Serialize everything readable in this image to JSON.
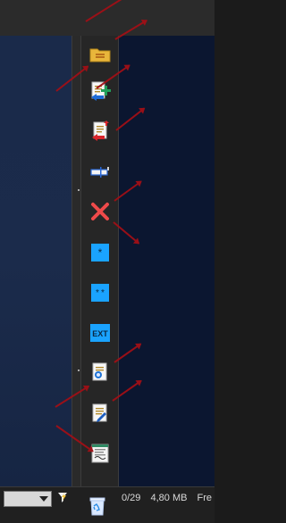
{
  "status": {
    "count": "0/29",
    "size": "4,80 MB",
    "truncated_tail": "Fre"
  },
  "toolbar": {
    "buttons": [
      {
        "name": "open-folder-button",
        "icon": "folder-icon"
      },
      {
        "name": "new-document-button",
        "icon": "document-add-icon"
      },
      {
        "name": "document-move-button",
        "icon": "document-transfer-icon"
      },
      {
        "name": "rename-button",
        "icon": "rename-cursor-icon"
      },
      {
        "name": "delete-button",
        "icon": "delete-x-icon"
      },
      {
        "name": "filter-star-button",
        "icon": "single-star-icon"
      },
      {
        "name": "filter-double-star-button",
        "icon": "double-star-icon"
      },
      {
        "name": "extension-button",
        "icon": "ext-label-icon",
        "label": "EXT"
      },
      {
        "name": "find-in-document-button",
        "icon": "document-search-icon"
      },
      {
        "name": "edit-document-button",
        "icon": "document-edit-icon"
      },
      {
        "name": "print-preview-button",
        "icon": "printer-document-icon"
      }
    ]
  },
  "colors": {
    "accent_red": "#a10f16",
    "blue_tile": "#1aa3ff",
    "folder_yellow": "#f4c542"
  }
}
